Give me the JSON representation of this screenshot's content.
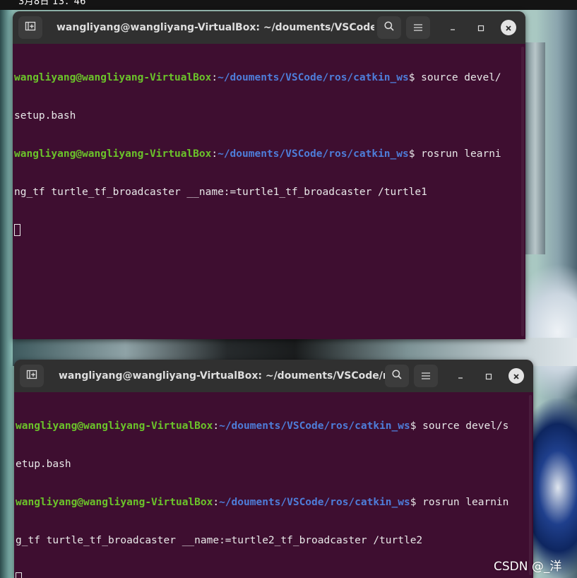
{
  "topbar": {
    "clock": "3月8日  13：46"
  },
  "icons": {
    "new_tab": "new-tab-icon",
    "search": "search-icon",
    "menu": "hamburger-menu-icon",
    "minimize": "minimize-icon",
    "maximize": "maximize-icon",
    "close": "close-icon"
  },
  "colors": {
    "terminal_bg": "#3e0e30",
    "titlebar_bg": "#303030",
    "prompt_user": "#6bc32a",
    "prompt_path": "#4e7dd9",
    "text": "#e8e8e8"
  },
  "terminal1": {
    "title": "wangliyang@wangliyang-VirtualBox: ~/douments/VSCode/...",
    "lines": [
      {
        "user": "wangliyang@wangliyang-VirtualBox",
        "sep": ":",
        "path": "~/douments/VSCode/ros/catkin_ws",
        "cmd": "$ source devel/"
      },
      {
        "text": "setup.bash"
      },
      {
        "user": "wangliyang@wangliyang-VirtualBox",
        "sep": ":",
        "path": "~/douments/VSCode/ros/catkin_ws",
        "cmd": "$ rosrun learni"
      },
      {
        "text": "ng_tf turtle_tf_broadcaster __name:=turtle1_tf_broadcaster /turtle1"
      }
    ]
  },
  "terminal2": {
    "title": "wangliyang@wangliyang-VirtualBox: ~/douments/VSCode/r...",
    "lines": [
      {
        "user": "wangliyang@wangliyang-VirtualBox",
        "sep": ":",
        "path": "~/douments/VSCode/ros/catkin_ws",
        "cmd": "$ source devel/s"
      },
      {
        "text": "etup.bash"
      },
      {
        "user": "wangliyang@wangliyang-VirtualBox",
        "sep": ":",
        "path": "~/douments/VSCode/ros/catkin_ws",
        "cmd": "$ rosrun learnin"
      },
      {
        "text": "g_tf turtle_tf_broadcaster __name:=turtle2_tf_broadcaster /turtle2"
      }
    ]
  },
  "watermark": "CSDN @_洋"
}
